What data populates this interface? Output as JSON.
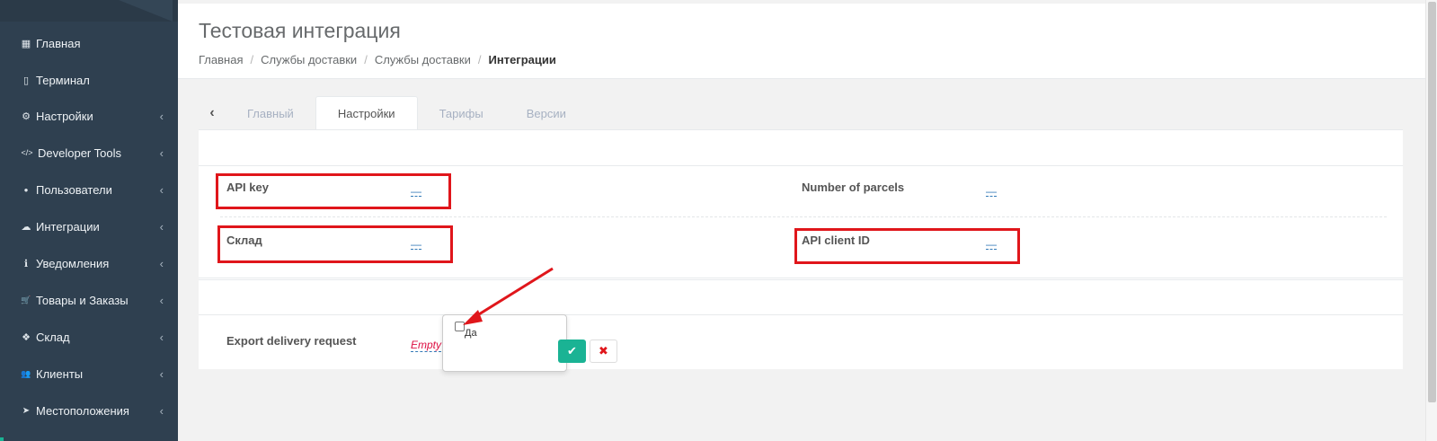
{
  "sidebar": {
    "items": [
      {
        "icon": "grid-icon",
        "glyph": "▦",
        "label": "Главная",
        "chevron": ""
      },
      {
        "icon": "tablet-icon",
        "glyph": "▯",
        "label": "Терминал",
        "chevron": ""
      },
      {
        "icon": "gear-icon",
        "glyph": "⚙",
        "label": "Настройки",
        "chevron": "‹"
      },
      {
        "icon": "code-icon",
        "glyph": "</>",
        "label": "Developer Tools",
        "chevron": "‹"
      },
      {
        "icon": "user-icon",
        "glyph": "●",
        "label": "Пользователи",
        "chevron": "‹"
      },
      {
        "icon": "cloud-download-icon",
        "glyph": "☁",
        "label": "Интеграции",
        "chevron": "‹"
      },
      {
        "icon": "info-icon",
        "glyph": "ℹ",
        "label": "Уведомления",
        "chevron": "‹"
      },
      {
        "icon": "cart-icon",
        "glyph": "🛒",
        "label": "Товары и Заказы",
        "chevron": "‹"
      },
      {
        "icon": "cubes-icon",
        "glyph": "❖",
        "label": "Склад",
        "chevron": "‹"
      },
      {
        "icon": "users-icon",
        "glyph": "👥",
        "label": "Клиенты",
        "chevron": "‹"
      },
      {
        "icon": "location-arrow-icon",
        "glyph": "➤",
        "label": "Местоположения",
        "chevron": "‹"
      }
    ]
  },
  "header": {
    "title": "Тестовая интеграция",
    "breadcrumb": [
      "Главная",
      "Службы доставки",
      "Службы доставки",
      "Интеграции"
    ],
    "separator": "/"
  },
  "tabs": {
    "back_glyph": "‹",
    "items": [
      "Главный",
      "Настройки",
      "Тарифы",
      "Версии"
    ],
    "active": "Настройки"
  },
  "settings": {
    "api_key": {
      "label": "API key",
      "value": "—"
    },
    "number_of_parcels": {
      "label": "Number of parcels",
      "value": "—"
    },
    "sklad": {
      "label": "Склад",
      "value": "—"
    },
    "api_client_id": {
      "label": "API client ID",
      "value": "—"
    },
    "export_delivery_request": {
      "label": "Export delivery request",
      "value": "Empty"
    }
  },
  "editor": {
    "checkbox_label": "Да",
    "ok_glyph": "✔",
    "cancel_glyph": "✖"
  },
  "colors": {
    "sidebar_bg": "#2f4050",
    "accent": "#1ab394",
    "highlight_red": "#e0161b",
    "link_blue": "#337ab7"
  }
}
